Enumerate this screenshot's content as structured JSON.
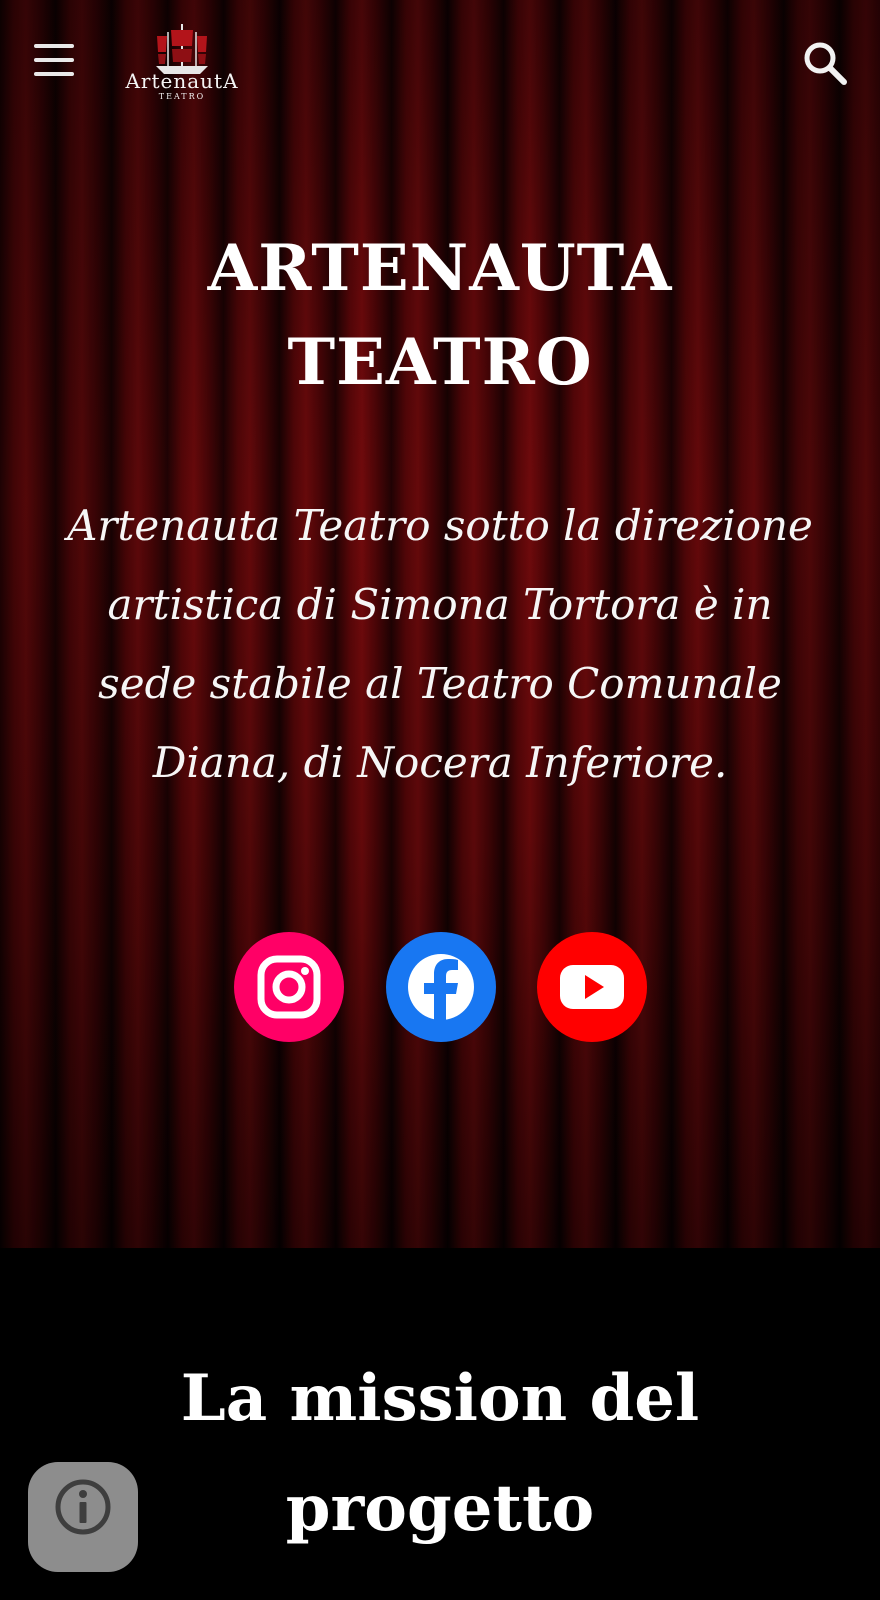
{
  "header": {
    "logo_name": "ArtenautA",
    "logo_sub": "TEATRO",
    "menu_icon": "hamburger-menu-icon",
    "search_icon": "search-icon"
  },
  "hero": {
    "title": "ARTENAUTA TEATRO",
    "description": "Artenauta Teatro sotto la direzione artistica di Simona Tortora è in sede stabile al Teatro Comunale Diana, di Nocera Inferiore."
  },
  "socials": [
    {
      "network": "instagram-icon",
      "color": "#ff0066"
    },
    {
      "network": "facebook-icon",
      "color": "#1877f2"
    },
    {
      "network": "youtube-icon",
      "color": "#ff0000"
    }
  ],
  "mission": {
    "title": "La mission del progetto"
  },
  "colors": {
    "curtain": "#5a0709",
    "background": "#000000",
    "info_button": "#8d8d8d"
  }
}
